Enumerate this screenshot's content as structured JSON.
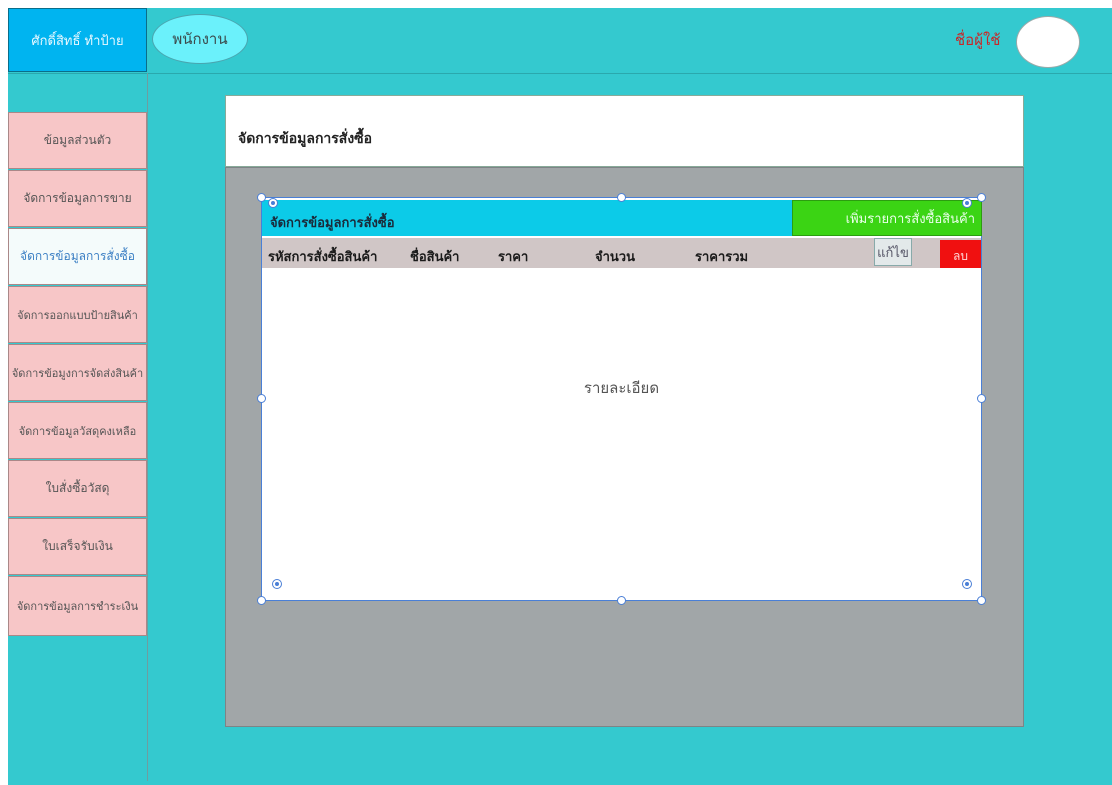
{
  "header": {
    "brand": "ศักดิ์สิทธิ์ ทำป้าย",
    "role": "พนักงาน",
    "user_name": "ชื่อผู้ใช้"
  },
  "sidebar": {
    "items": [
      {
        "label": "ข้อมูลส่วนตัว",
        "active": false
      },
      {
        "label": "จัดการข้อมูลการขาย",
        "active": false
      },
      {
        "label": "จัดการข้อมูลการสั่งซื้อ",
        "active": true
      },
      {
        "label": "จัดการออกแบบป้ายสินค้า",
        "active": false
      },
      {
        "label": "จัดการข้อมูงการจัดส่งสินค้า",
        "active": false
      },
      {
        "label": "จัดการข้อมูลวัสดุคงเหลือ",
        "active": false
      },
      {
        "label": "ใบสั่งซื้อวัสดุ",
        "active": false
      },
      {
        "label": "ใบเสร็จรับเงิน",
        "active": false
      },
      {
        "label": "จัดการข้อมูลการชำระเงิน",
        "active": false
      }
    ]
  },
  "main": {
    "page_title": "จัดการข้อมูลการสั่งซื้อ",
    "card_title": "จัดการข้อมูลการสั่งซื้อ",
    "add_button": "เพิ่มรายการสั่งซื้อสินค้า",
    "columns": [
      "รหัสการสั่งซื้อสินค้า",
      "ชื่อสินค้า",
      "ราคา",
      "จำนวน",
      "ราคารวม"
    ],
    "edit_button": "แก้ไข",
    "delete_button": "ลบ",
    "detail_text": "รายละเอียด"
  },
  "colors": {
    "background": "#34c9cf",
    "sidebar_item": "#f7c6c7",
    "active_item": "#f4fbfb",
    "card_header": "#0ccbe8",
    "add_button": "#3bd414",
    "delete_button": "#f01010",
    "content_panel": "#a1a6a8"
  }
}
